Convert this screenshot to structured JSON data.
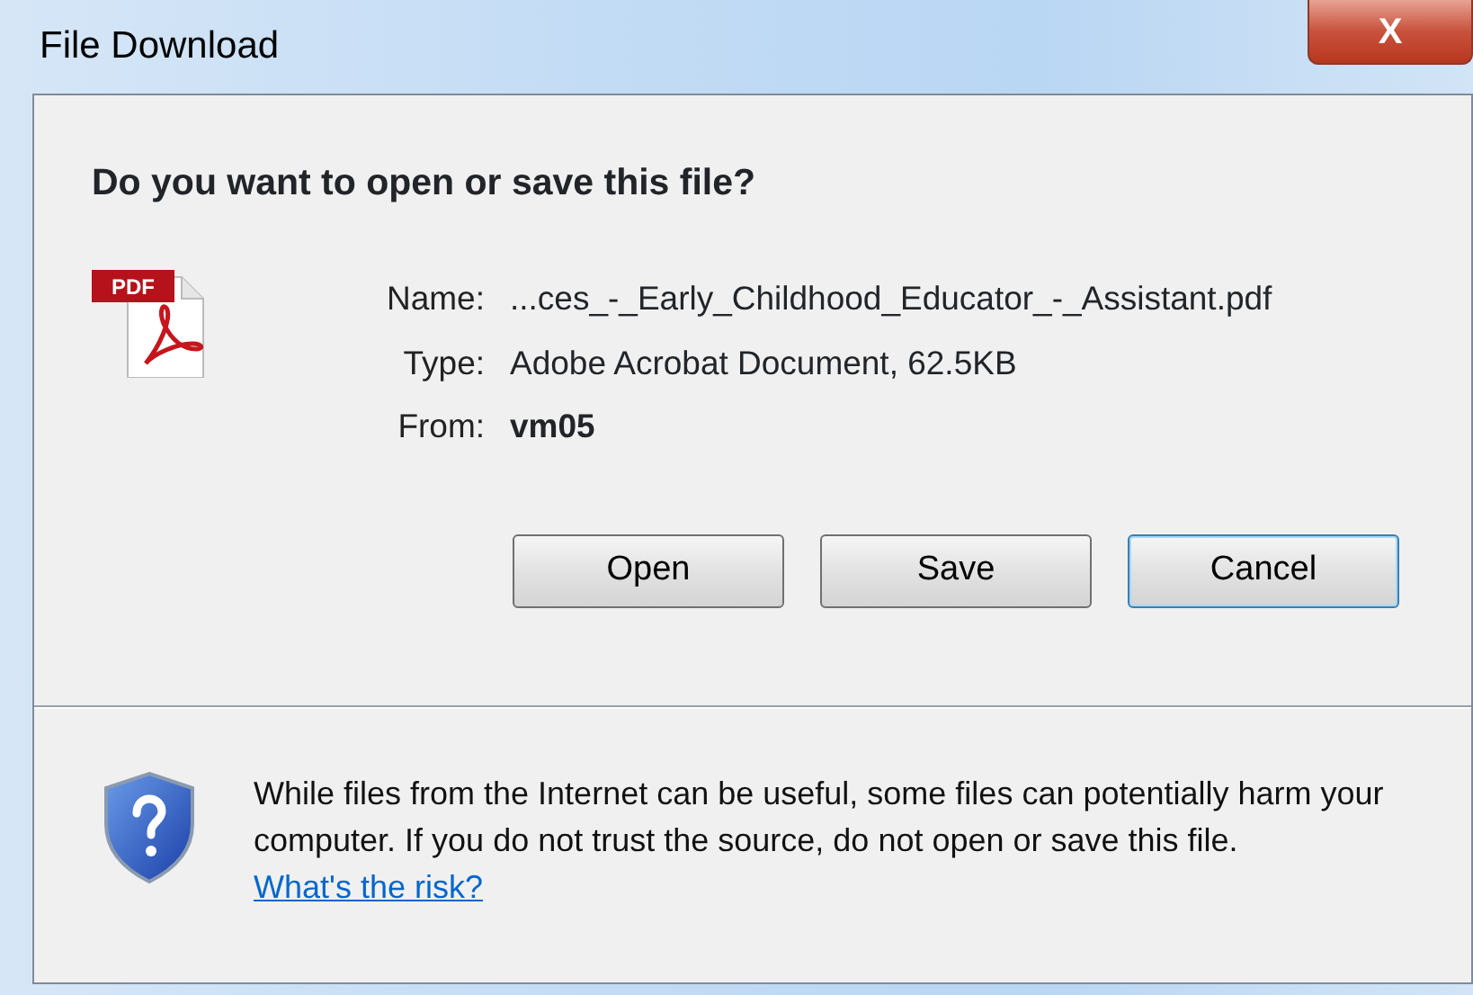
{
  "window": {
    "title": "File Download",
    "close_glyph": "X"
  },
  "prompt": "Do you want to open or save this file?",
  "file_icon_label": "PDF",
  "details": [
    {
      "label": "Name:",
      "value": "...ces_-_Early_Childhood_Educator_-_Assistant.pdf",
      "bold": false
    },
    {
      "label": "Type:",
      "value": "Adobe Acrobat Document, 62.5KB",
      "bold": false
    },
    {
      "label": "From:",
      "value": "vm05",
      "bold": true
    }
  ],
  "buttons": [
    {
      "label": "Open",
      "focused": false
    },
    {
      "label": "Save",
      "focused": false
    },
    {
      "label": "Cancel",
      "focused": true
    }
  ],
  "warning": {
    "text": "While files from the Internet can be useful, some files can potentially harm your computer. If you do not trust the source, do not open or save this file.",
    "link": "What's the risk?"
  }
}
